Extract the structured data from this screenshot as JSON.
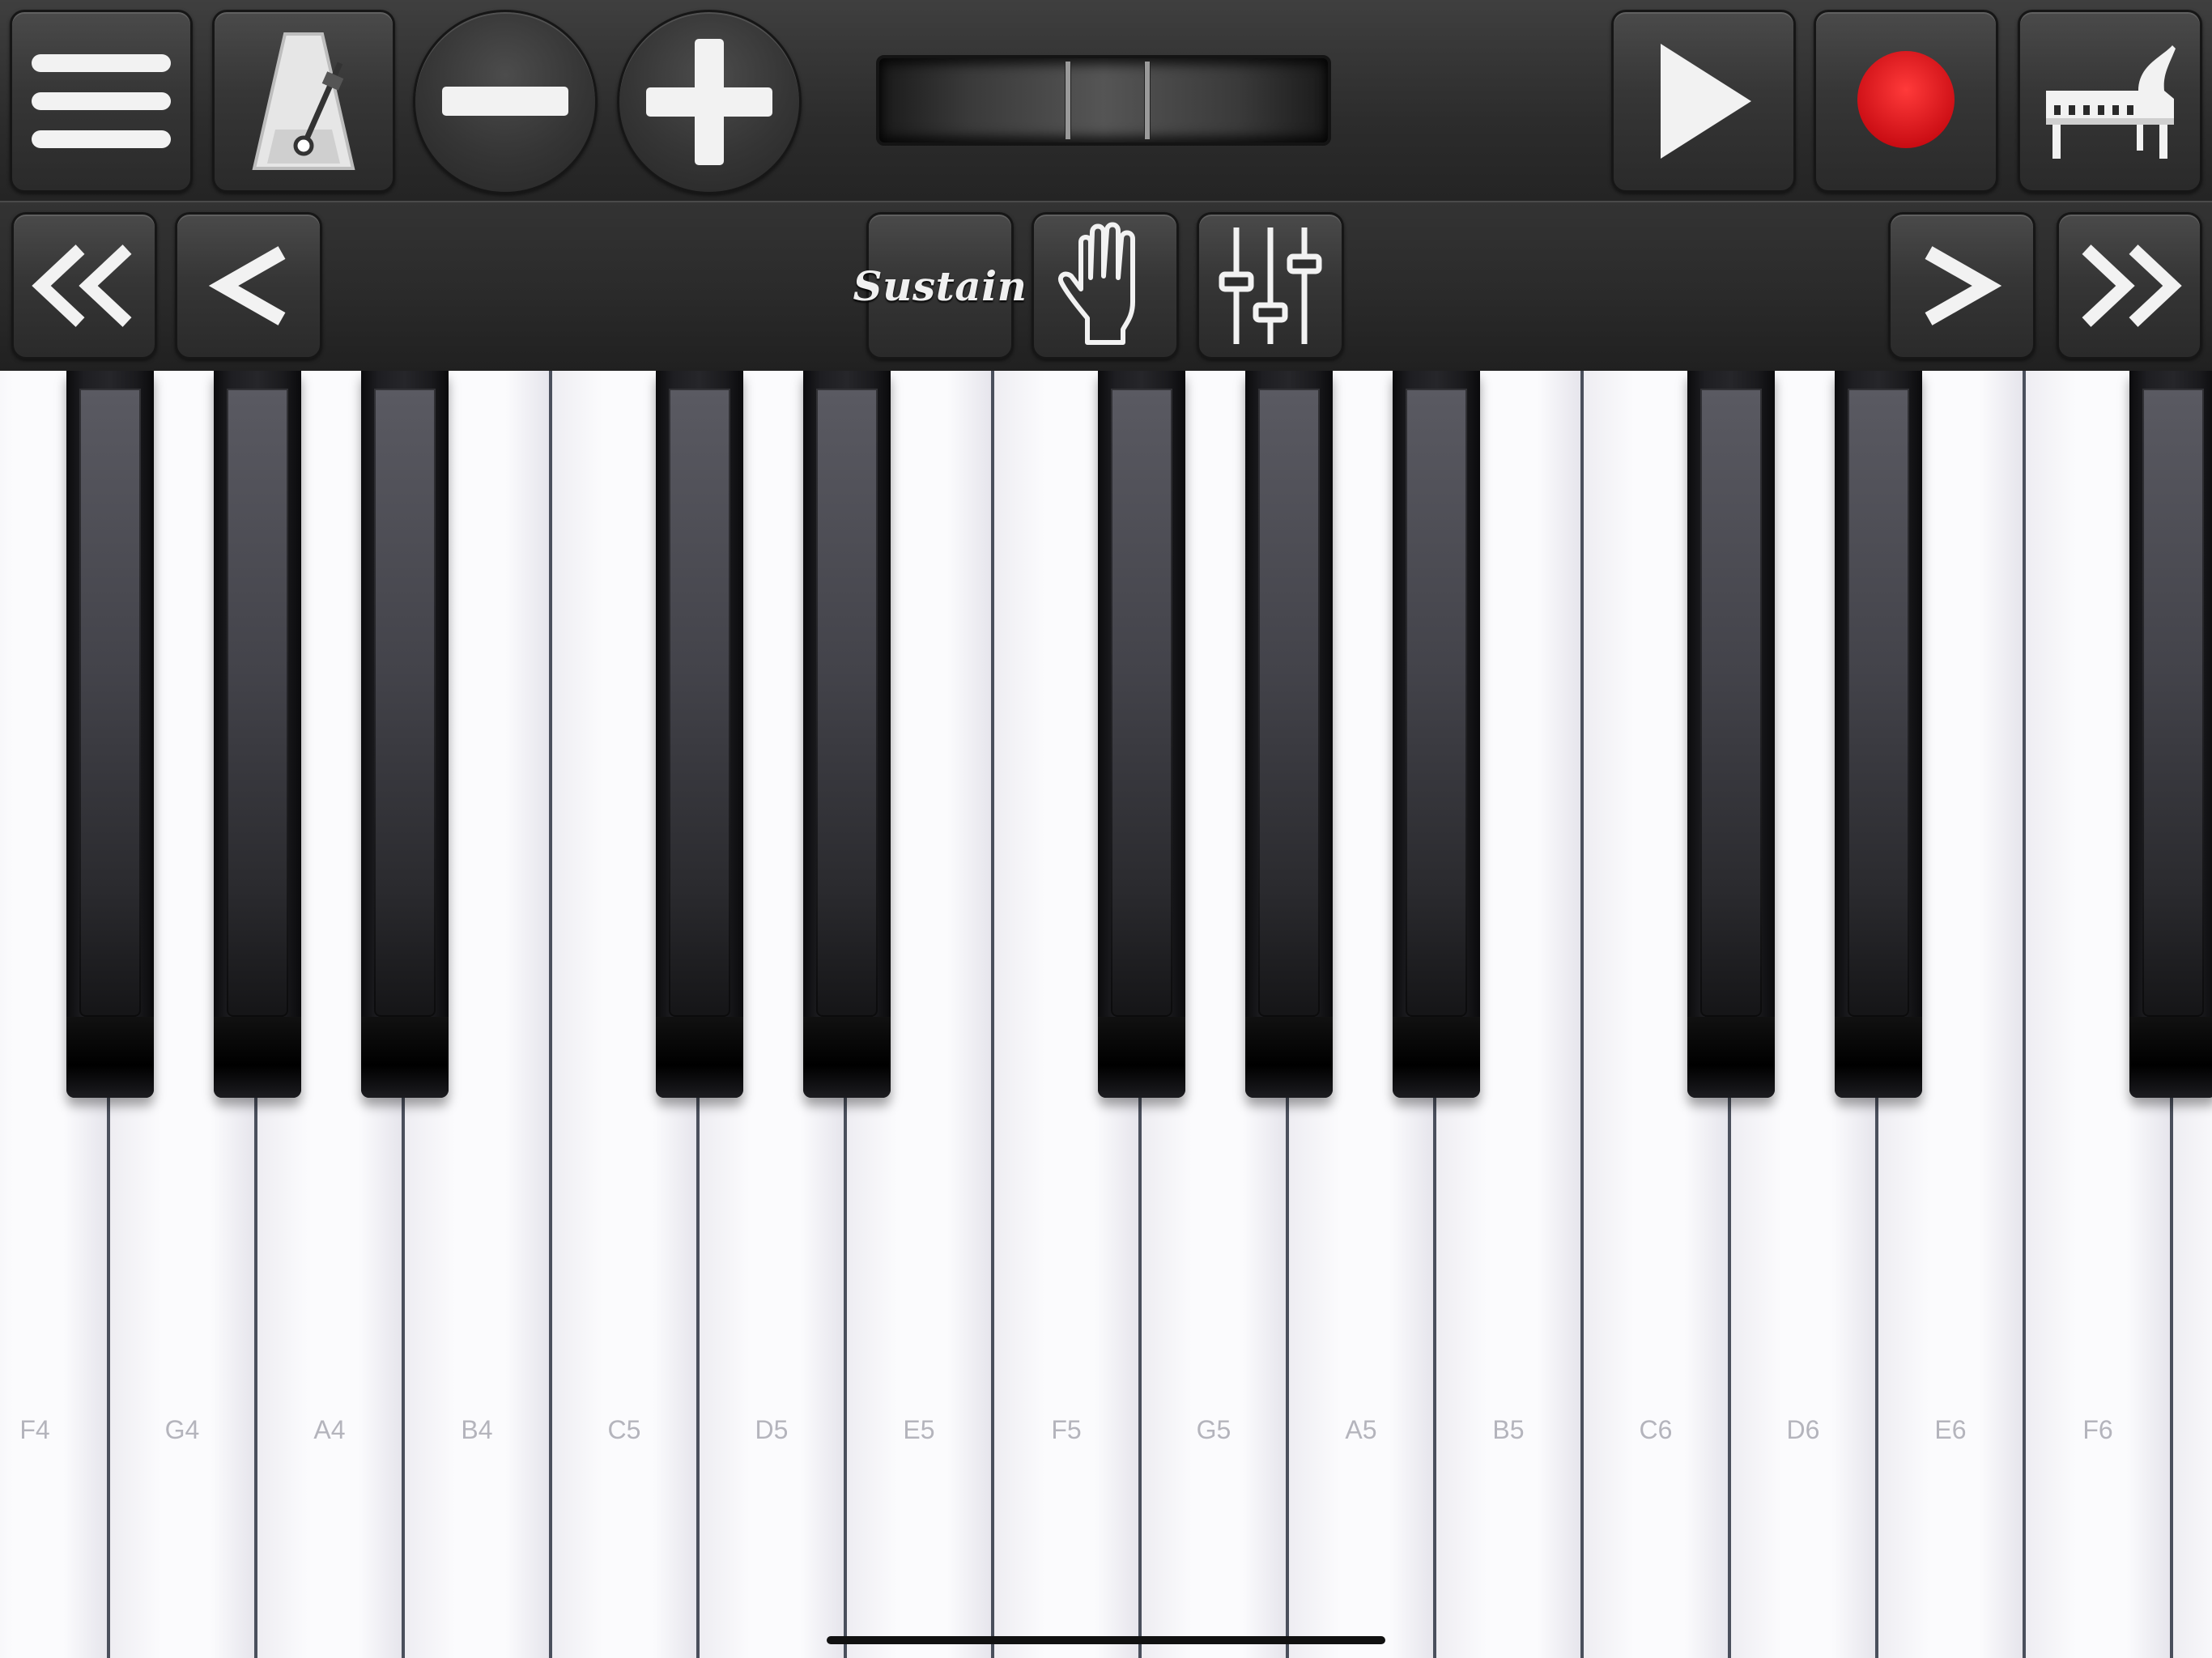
{
  "toolbar": {
    "menu_icon": "hamburger-menu-icon",
    "metronome_icon": "metronome-icon",
    "minus_icon": "minus-icon",
    "plus_icon": "plus-icon",
    "play_icon": "play-icon",
    "record_icon": "record-icon",
    "record_color": "#e0141b",
    "piano_icon": "grand-piano-icon"
  },
  "nav": {
    "fast_back_icon": "double-chevron-left-icon",
    "back_icon": "chevron-left-icon",
    "sustain_label": "Sustain",
    "hand_icon": "hand-icon",
    "mixer_icon": "sliders-icon",
    "forward_icon": "chevron-right-icon",
    "fast_forward_icon": "double-chevron-right-icon"
  },
  "keyboard": {
    "white_keys": [
      "F4",
      "G4",
      "A4",
      "B4",
      "C5",
      "D5",
      "E5",
      "F5",
      "G5",
      "A5",
      "B5",
      "C6",
      "D6",
      "E6",
      "F6"
    ],
    "black_keys_after_white_index": [
      0,
      1,
      2,
      4,
      5,
      7,
      8,
      9,
      11,
      12,
      14
    ]
  }
}
